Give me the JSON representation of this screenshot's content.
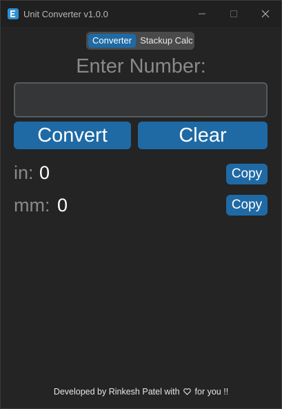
{
  "window": {
    "title": "Unit Converter v1.0.0"
  },
  "tabs": [
    {
      "label": "Converter",
      "active": true
    },
    {
      "label": "Stackup Calc",
      "active": false
    }
  ],
  "main": {
    "heading": "Enter Number:",
    "input_value": "",
    "convert_label": "Convert",
    "clear_label": "Clear"
  },
  "results": [
    {
      "unit_label": "in:",
      "value": "0",
      "copy_label": "Copy"
    },
    {
      "unit_label": "mm:",
      "value": "0",
      "copy_label": "Copy"
    }
  ],
  "footer": {
    "prefix": "Developed by Rinkesh Patel with",
    "suffix": "for you !!"
  },
  "colors": {
    "accent": "#1f6aa5",
    "background": "#242424",
    "entry_bg": "#343638"
  }
}
